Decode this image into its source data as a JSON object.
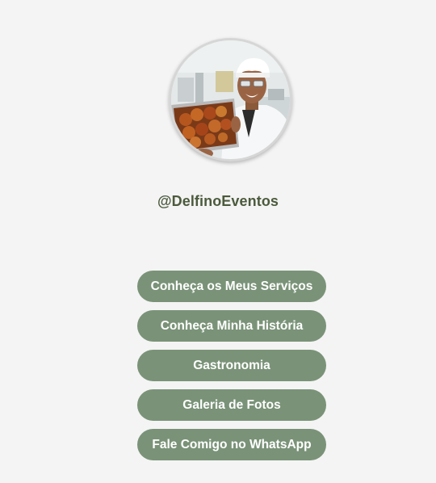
{
  "profile": {
    "handle": "@DelfinoEventos",
    "avatar": "profile-photo"
  },
  "links": [
    {
      "label": "Conheça os Meus Serviços"
    },
    {
      "label": "Conheça Minha História"
    },
    {
      "label": "Gastronomia"
    },
    {
      "label": "Galeria de Fotos"
    },
    {
      "label": "Fale Comigo no WhatsApp"
    }
  ],
  "colors": {
    "background": "#f4f4f4",
    "handle_text": "#4b5a3c",
    "button_bg": "#7a9378",
    "button_text": "#ffffff"
  }
}
